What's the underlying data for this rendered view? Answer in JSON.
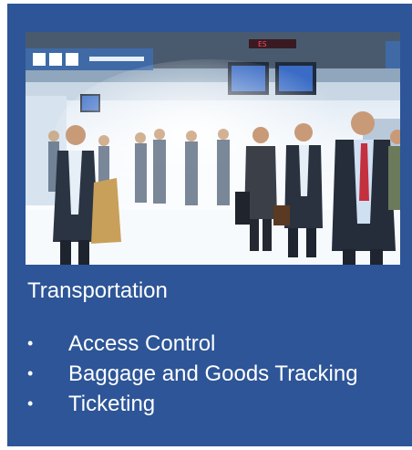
{
  "card": {
    "title": "Transportation",
    "bullet_glyph": "•",
    "items": [
      {
        "label": "Access Control"
      },
      {
        "label": "Baggage and Goods Tracking"
      },
      {
        "label": "Ticketing"
      }
    ]
  },
  "image": {
    "subject": "busy airport terminal with walking travelers and flight information displays",
    "sign_text": "ES",
    "colors": {
      "card_bg": "#2d5597",
      "text": "#ffffff"
    }
  }
}
